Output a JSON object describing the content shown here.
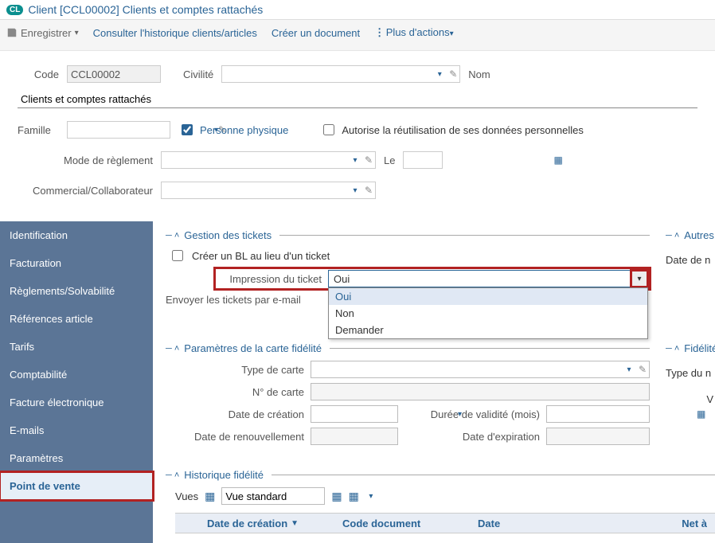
{
  "title": {
    "badge": "CL",
    "text": "Client [CCL00002] Clients et comptes rattachés"
  },
  "toolbar": {
    "save": "Enregistrer",
    "history": "Consulter l'historique clients/articles",
    "create_doc": "Créer un document",
    "more": "Plus d'actions"
  },
  "header": {
    "code_label": "Code",
    "code_value": "CCL00002",
    "civility_label": "Civilité",
    "civility_value": "",
    "name_label": "Nom",
    "name_value": "Clients et comptes rattachés",
    "family_label": "Famille",
    "family_value": "",
    "individual_label": "Personne physique",
    "individual_checked": true,
    "allow_reuse_label": "Autorise la réutilisation de ses données personnelles",
    "allow_reuse_checked": false,
    "pay_mode_label": "Mode de règlement",
    "pay_mode_value": "",
    "le_label": "Le",
    "le_value": "",
    "commercial_label": "Commercial/Collaborateur",
    "commercial_value": ""
  },
  "sidebar_items": [
    "Identification",
    "Facturation",
    "Règlements/Solvabilité",
    "Références article",
    "Tarifs",
    "Comptabilité",
    "Facture électronique",
    "E-mails",
    "Paramètres",
    "Point de vente"
  ],
  "sidebar_active_index": 9,
  "tickets": {
    "group_title": "Gestion des tickets",
    "create_bl_label": "Créer un BL au lieu d'un ticket",
    "create_bl_checked": false,
    "print_label": "Impression du ticket",
    "print_value": "Oui",
    "print_options": [
      "Oui",
      "Non",
      "Demander"
    ],
    "email_label": "Envoyer les tickets par e-mail"
  },
  "other_group": {
    "title": "Autres",
    "date_label": "Date de n"
  },
  "loyalty": {
    "group_title": "Paramètres de la carte fidélité",
    "card_type_label": "Type de carte",
    "card_type_value": "",
    "card_num_label": "N° de carte",
    "card_num_value": "",
    "create_date_label": "Date de création",
    "create_date_value": "",
    "validity_label": "Durée de validité (mois)",
    "validity_value": "",
    "renew_label": "Date de renouvellement",
    "renew_value": "",
    "expire_label": "Date d'expiration",
    "expire_value": ""
  },
  "loyalty_right": {
    "title": "Fidélité",
    "type_label": "Type du n",
    "v_label": "V"
  },
  "history": {
    "group_title": "Historique fidélité",
    "views_label": "Vues",
    "view_value": "Vue standard",
    "col_create": "Date de création",
    "col_doc": "Code document",
    "col_date": "Date",
    "col_net": "Net à"
  }
}
